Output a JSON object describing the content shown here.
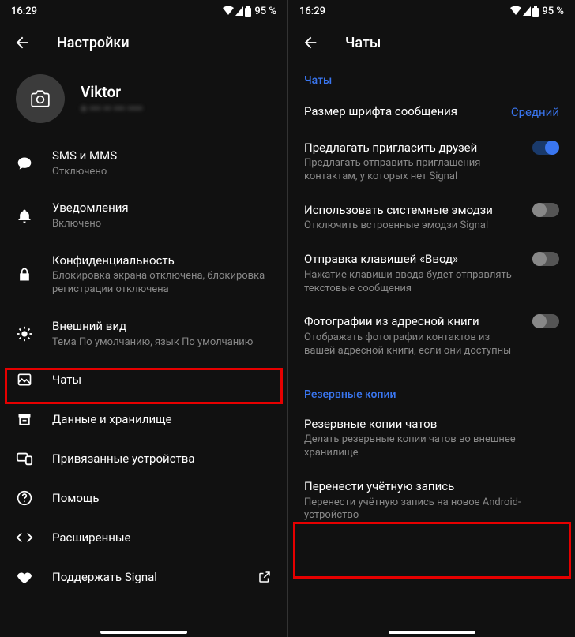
{
  "status": {
    "time": "16:29",
    "battery": "95 %"
  },
  "left": {
    "header_title": "Настройки",
    "profile": {
      "name": "Viktor",
      "sub": "+ ••• •• ••• ••••"
    },
    "rows": [
      {
        "icon": "chat-bubble",
        "title": "SMS и MMS",
        "sub": "Отключено"
      },
      {
        "icon": "bell",
        "title": "Уведомления",
        "sub": "Включено"
      },
      {
        "icon": "lock",
        "title": "Конфиденциальность",
        "sub": "Блокировка экрана отключена, блокировка регистрации отключена"
      },
      {
        "icon": "sun",
        "title": "Внешний вид",
        "sub": "Тема По умолчанию, язык По умолчанию"
      },
      {
        "icon": "image",
        "title": "Чаты",
        "sub": ""
      },
      {
        "icon": "archive",
        "title": "Данные и хранилище",
        "sub": ""
      },
      {
        "icon": "devices",
        "title": "Привязанные устройства",
        "sub": ""
      },
      {
        "icon": "help",
        "title": "Помощь",
        "sub": ""
      },
      {
        "icon": "code",
        "title": "Расширенные",
        "sub": ""
      },
      {
        "icon": "heart",
        "title": "Поддержать Signal",
        "sub": "",
        "trail": "external"
      }
    ]
  },
  "right": {
    "header_title": "Чаты",
    "section1": "Чаты",
    "font_row": {
      "title": "Размер шрифта сообщения",
      "value": "Средний"
    },
    "toggles": [
      {
        "title": "Предлагать пригласить друзей",
        "sub": "Предлагать отправить приглашения контактам, у которых нет Signal",
        "on": true
      },
      {
        "title": "Использовать системные эмодзи",
        "sub": "Отключить встроенные эмодзи Signal",
        "on": false
      },
      {
        "title": "Отправка клавишей «Ввод»",
        "sub": "Нажатие клавиши ввода будет отправлять текстовые сообщения",
        "on": false
      },
      {
        "title": "Фотографии из адресной книги",
        "sub": "Отображать фотографии контактов из вашей адресной книги, если они доступны",
        "on": false
      }
    ],
    "section2": "Резервные копии",
    "backup_rows": [
      {
        "title": "Резервные копии чатов",
        "sub": "Делать резервные копии чатов во внешнее хранилище"
      },
      {
        "title": "Перенести учётную запись",
        "sub": "Перенести учётную запись на новое Android-устройство"
      }
    ]
  }
}
